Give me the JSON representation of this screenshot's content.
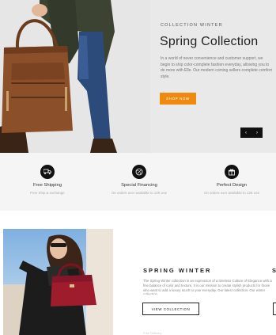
{
  "hero": {
    "subtitle": "COLLECTION WINTER",
    "title": "Spring Collection",
    "description": "In a world of never convenience and customer support, we begin to ship color-complete fashion everyday, allowing you to do more with Elle. Our modern coming sellers complete comfort style.",
    "button_label": "SHOP NOW",
    "prev_arrow": "‹",
    "next_arrow": "›"
  },
  "features": [
    {
      "icon": "truck-icon",
      "title": "Free Shipping",
      "desc": "Free Ship & exchange"
    },
    {
      "icon": "percent-icon",
      "title": "Special Financing",
      "desc": "On orders over available to 12K use"
    },
    {
      "icon": "gift-icon",
      "title": "Perfect Design",
      "desc": "On orders over available to 12K use"
    }
  ],
  "promo": {
    "title": "SPRING WINTER",
    "title_next": "S",
    "description": "The Spring Winter collection is an expression of a timeless Culture of Elegance with a fine balance of color and texture. It is our mission to create stylish products for those who want to add a luxury touch to your everyday. Our latest collection. Our winter collection.",
    "button_label": "VIEW COLLECTION",
    "footer_text": "Free Delivery"
  }
}
